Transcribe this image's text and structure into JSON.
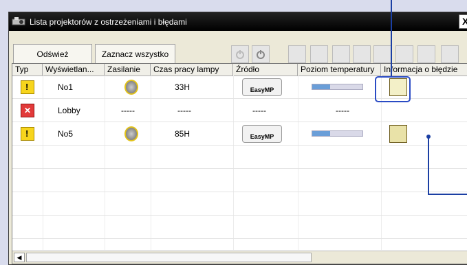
{
  "window": {
    "title": "Lista projektorów z ostrzeżeniami i błędami",
    "close_label": "X"
  },
  "toolbar": {
    "refresh_label": "Odśwież",
    "select_all_label": "Zaznacz wszystko",
    "icons": [
      "power-off-icon",
      "power-on-icon",
      "input-switch-icon",
      "input-switch-2-icon",
      "grid-icon",
      "video-mute-icon",
      "display-icon",
      "monitor-icon",
      "shutter-icon",
      "mute-icon"
    ]
  },
  "table": {
    "headers": [
      "Typ",
      "Wyświetlan...",
      "Zasilanie",
      "Czas pracy lampy",
      "Źródło",
      "Poziom temperatury",
      "Informacja o błędzie"
    ],
    "rows": [
      {
        "type": "warning",
        "name": "No1",
        "power": "on",
        "lamp": "33H",
        "source": "EasyMP",
        "temp": 0.35,
        "error": "error-icon-1"
      },
      {
        "type": "error",
        "name": "Lobby",
        "power": "-----",
        "lamp": "-----",
        "source": "-----",
        "temp": "-----",
        "error": ""
      },
      {
        "type": "warning",
        "name": "No5",
        "power": "on",
        "lamp": "85H",
        "source": "EasyMP",
        "temp": 0.35,
        "error": "error-icon-2"
      }
    ]
  },
  "ui": {
    "dash": "-----",
    "easy_text": "EasyMP",
    "err_symbol": "✕",
    "scroll_left": "◀"
  }
}
